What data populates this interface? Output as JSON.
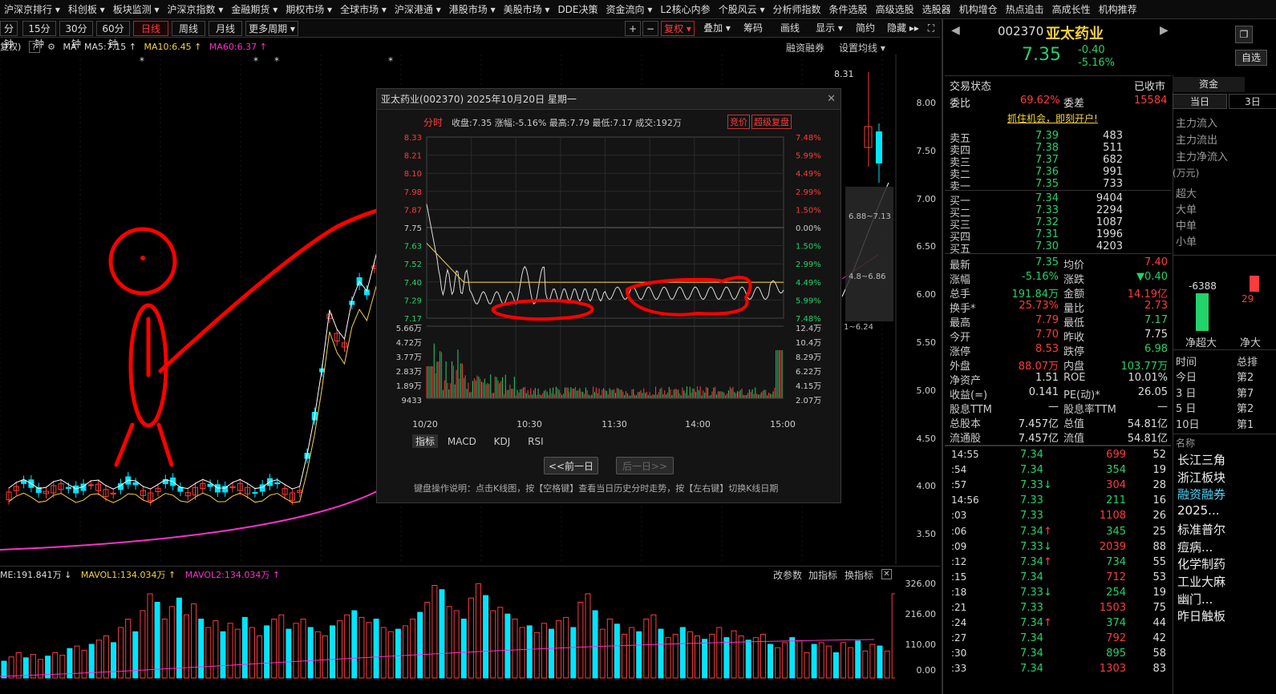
{
  "topmenu": [
    "沪深京排行 ▾",
    "科创板 ▾",
    "板块监测 ▾",
    "沪深京指数 ▾",
    "金融期货 ▾",
    "期权市场 ▾",
    "全球市场 ▾",
    "沪深港通 ▾",
    "港股市场 ▾",
    "美股市场 ▾",
    "DDE决策",
    "资金流向 ▾",
    "L2核心内参",
    "个股风云 ▾",
    "分析师指数",
    "条件选股",
    "高级选股",
    "选股器",
    "机构增仓",
    "热点追击",
    "高成长性",
    "机构推荐"
  ],
  "periods": [
    "分钟",
    "15分钟",
    "30分钟",
    "60分钟",
    "日线",
    "周线",
    "月线",
    "更多周期 ▾"
  ],
  "toolbar": {
    "fuquan": "复权 ▾",
    "diejia": "叠加 ▾",
    "chouma": "筹码",
    "huaxian": "画线",
    "xianshi": "显示 ▾",
    "jianyue": "简约",
    "yincang": "隐藏 ▸▸"
  },
  "legend": {
    "fq": "复权)",
    "ma_label": "MA",
    "ma5": "MA5:7.15 ↑",
    "ma10": "MA10:6.45 ↑",
    "ma60": "MA60:6.37 ↑",
    "rzrq": "融资融券",
    "setma": "设置均线 ▾"
  },
  "price_axis": [
    "8.00",
    "7.50",
    "7.00",
    "6.50",
    "6.00",
    "5.50",
    "5.00",
    "4.50",
    "4.00",
    "3.50"
  ],
  "high_label": "8.31",
  "range_label_a": "6.88~7.13",
  "range_label_b": "4.8~6.86",
  "range_label_c": "1~6.24",
  "vol_legend": {
    "vol": "ME:191.841万 ↓",
    "mavol1": "MAVOL1:134.034万 ↑",
    "mavol2": "MAVOL2:134.034万 ↑",
    "gai": "改参数",
    "jia": "加指标",
    "huan": "换指标"
  },
  "vol_axis": [
    "326.00",
    "216.00",
    "110.00",
    "0.00"
  ],
  "popup": {
    "title": "亚太药业(002370) 2025年10月20日 星期一",
    "fenshi": "分时",
    "stats": "收盘:7.35 涨幅:-5.16% 最高:7.79 最低:7.17 成交:192万",
    "jingjia": "竞价",
    "chaoji": "超级复盘",
    "left_axis": [
      "8.33",
      "8.21",
      "8.10",
      "7.98",
      "7.87",
      "7.75",
      "7.63",
      "7.52",
      "7.40",
      "7.29",
      "7.17"
    ],
    "right_axis": [
      "7.48%",
      "5.99%",
      "4.49%",
      "2.99%",
      "1.50%",
      "0.00%",
      "1.50%",
      "2.99%",
      "4.49%",
      "5.99%",
      "7.48%"
    ],
    "vol_left": [
      "5.66万",
      "4.72万",
      "3.77万",
      "2.83万",
      "1.89万",
      "9433"
    ],
    "vol_right": [
      "12.4万",
      "10.4万",
      "8.29万",
      "6.22万",
      "4.15万",
      "2.07万"
    ],
    "time_axis": [
      "10/20",
      "10:30",
      "11:30",
      "14:00",
      "15:00"
    ],
    "tabs": [
      "指标",
      "MACD",
      "KDJ",
      "RSI"
    ],
    "prev": "<<前一日",
    "next": "后一日>>",
    "help": "键盘操作说明：点击K线图，按【空格键】查看当日历史分时走势，按【左右键】切换K线日期"
  },
  "quote": {
    "code": "002370",
    "name": "亚太药业",
    "price": "7.35",
    "chg": "-0.40",
    "pct": "-5.16%",
    "status_label": "交易状态",
    "status": "已收市",
    "webi_label": "委比",
    "webi": "69.62%",
    "wecha_label": "委差",
    "wecha": "15584",
    "ad": "抓住机会，即刻开户!",
    "sells": [
      [
        "卖五",
        "7.39",
        "483"
      ],
      [
        "卖四",
        "7.38",
        "511"
      ],
      [
        "卖三",
        "7.37",
        "682"
      ],
      [
        "卖二",
        "7.36",
        "991"
      ],
      [
        "卖一",
        "7.35",
        "733"
      ]
    ],
    "buys": [
      [
        "买一",
        "7.34",
        "9404"
      ],
      [
        "买二",
        "7.33",
        "2294"
      ],
      [
        "买三",
        "7.32",
        "1087"
      ],
      [
        "买四",
        "7.31",
        "1996"
      ],
      [
        "买五",
        "7.30",
        "4203"
      ]
    ],
    "stats": [
      [
        "最新",
        "7.35",
        "均价",
        "7.40"
      ],
      [
        "涨幅",
        "-5.16%",
        "涨跌",
        "▼0.40"
      ],
      [
        "总手",
        "191.84万",
        "金额",
        "14.19亿"
      ],
      [
        "换手*",
        "25.73%",
        "量比",
        "2.73"
      ],
      [
        "最高",
        "7.79",
        "最低",
        "7.17"
      ],
      [
        "今开",
        "7.70",
        "昨收",
        "7.75"
      ],
      [
        "涨停",
        "8.53",
        "跌停",
        "6.98"
      ],
      [
        "外盘",
        "88.07万",
        "内盘",
        "103.77万"
      ],
      [
        "净资产",
        "1.51",
        "ROE",
        "10.01%"
      ],
      [
        "收益(=)",
        "0.141",
        "PE(动)*",
        "26.05"
      ],
      [
        "股息TTM",
        "—",
        "股息率TTM",
        "—"
      ],
      [
        "总股本",
        "7.457亿",
        "总值",
        "54.81亿"
      ],
      [
        "流通股",
        "7.457亿",
        "流值",
        "54.81亿"
      ]
    ],
    "ticks": [
      [
        "14:55",
        "7.34",
        "699",
        "52",
        ""
      ],
      [
        ":54",
        "7.34",
        "354",
        "19",
        ""
      ],
      [
        ":57",
        "7.33",
        "304",
        "28",
        "↓"
      ],
      [
        "14:56",
        "7.33",
        "211",
        "16",
        ""
      ],
      [
        ":03",
        "7.33",
        "1108",
        "26",
        ""
      ],
      [
        ":06",
        "7.34",
        "345",
        "25",
        "↑"
      ],
      [
        ":09",
        "7.33",
        "2039",
        "88",
        "↓"
      ],
      [
        ":12",
        "7.34",
        "734",
        "55",
        "↑"
      ],
      [
        ":15",
        "7.34",
        "712",
        "53",
        ""
      ],
      [
        ":18",
        "7.33",
        "254",
        "19",
        "↓"
      ],
      [
        ":21",
        "7.33",
        "1503",
        "75",
        ""
      ],
      [
        ":24",
        "7.34",
        "374",
        "44",
        "↑"
      ],
      [
        ":27",
        "7.34",
        "792",
        "42",
        ""
      ],
      [
        ":30",
        "7.34",
        "895",
        "58",
        ""
      ],
      [
        ":33",
        "7.34",
        "1303",
        "83",
        ""
      ]
    ]
  },
  "side": {
    "tab_zijin": "资金",
    "tab_dangri": "当日",
    "tab_3r": "3日",
    "flows": [
      "主力流入",
      "主力流出",
      "主力净流入"
    ],
    "unit": "(万元)",
    "sizes": [
      "超大",
      "大单",
      "中单",
      "小单"
    ],
    "bar_val": "-6388",
    "bar_val2": "29",
    "bar_label": "净超大",
    "bar_label2": "净大",
    "time_label": "时间",
    "time_label2": "总排",
    "periods": [
      "今日",
      "3 日",
      "5 日",
      "10日"
    ],
    "ranks": [
      "第2",
      "第7",
      "第2",
      "第1"
    ],
    "name_label": "名称",
    "blocks": [
      "长江三角",
      "浙江板块",
      "融资融券",
      "2025...",
      "标准普尔",
      "痘病...",
      "化学制药",
      "工业大麻",
      "幽门...",
      "昨日触板"
    ],
    "zixuan": "自选"
  },
  "colors": {
    "up": "#ff3b3b",
    "down": "#22d36a",
    "cyan": "#00e5ff",
    "yellow": "#f5d23a",
    "magenta": "#ff2fd0"
  }
}
